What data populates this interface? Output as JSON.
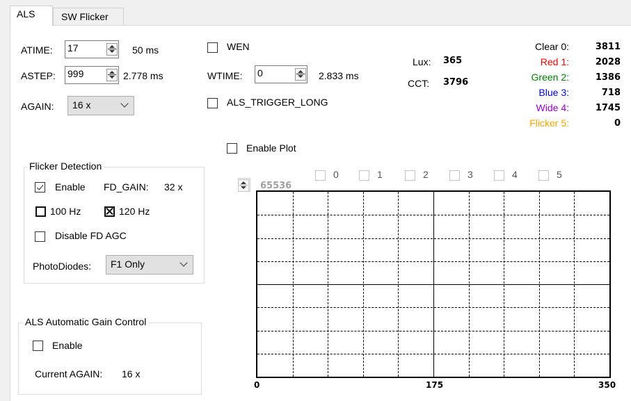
{
  "tabs": [
    {
      "label": "ALS"
    },
    {
      "label": "SW Flicker"
    }
  ],
  "atime": {
    "label": "ATIME:",
    "value": "17",
    "time": "50 ms"
  },
  "astep": {
    "label": "ASTEP:",
    "value": "999",
    "time": "2.778 ms"
  },
  "again": {
    "label": "AGAIN:",
    "value": "16 x"
  },
  "wen": {
    "label": "WEN",
    "checked": false
  },
  "wtime": {
    "label": "WTIME:",
    "value": "0",
    "time": "2.833 ms"
  },
  "als_trigger_long": {
    "label": "ALS_TRIGGER_LONG",
    "checked": false
  },
  "lux": {
    "label": "Lux:",
    "value": "365"
  },
  "cct": {
    "label": "CCT:",
    "value": "3796"
  },
  "channels": [
    {
      "label": "Clear 0:",
      "value": "3811",
      "color": "#000000"
    },
    {
      "label": "Red 1:",
      "value": "2028",
      "color": "#ff0000"
    },
    {
      "label": "Green 2:",
      "value": "1386",
      "color": "#008000"
    },
    {
      "label": "Blue 3:",
      "value": "718",
      "color": "#0000ff"
    },
    {
      "label": "Wide 4:",
      "value": "1745",
      "color": "#9400d3"
    },
    {
      "label": "Flicker 5:",
      "value": "0",
      "color": "#ffa500"
    }
  ],
  "flicker": {
    "title": "Flicker Detection",
    "enable_label": "Enable",
    "enable_checked": true,
    "fd_gain_label": "FD_GAIN:",
    "fd_gain_value": "32 x",
    "hz100_label": "100 Hz",
    "hz120_label": "120 Hz",
    "disable_agc_label": "Disable FD AGC",
    "photodiodes_label": "PhotoDiodes:",
    "photodiodes_value": "F1 Only"
  },
  "agc": {
    "title": "ALS Automatic Gain Control",
    "enable_label": "Enable",
    "current_label": "Current AGAIN:",
    "current_value": "16 x"
  },
  "plot": {
    "enable_label": "Enable Plot",
    "ymax": "65536",
    "series_labels": [
      "0",
      "1",
      "2",
      "3",
      "4",
      "5"
    ],
    "x_ticks": [
      "0",
      "175",
      "350"
    ]
  }
}
